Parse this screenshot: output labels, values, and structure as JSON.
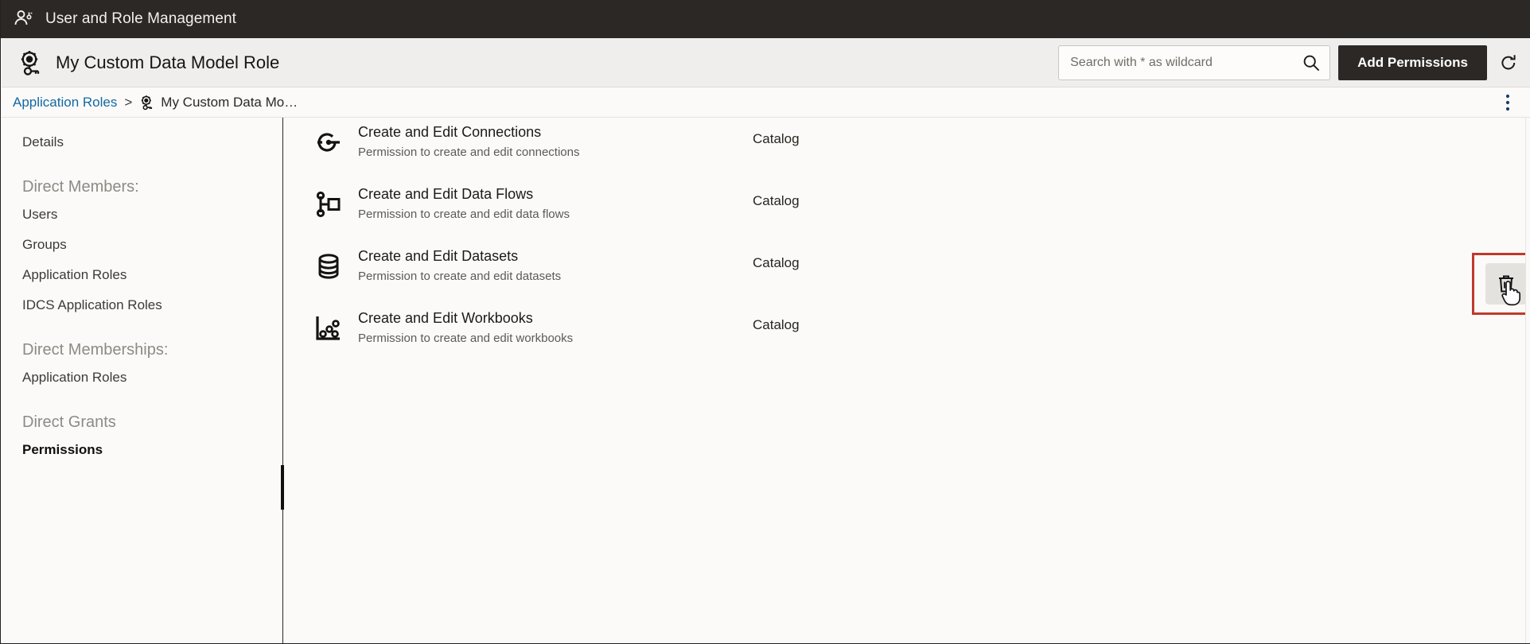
{
  "appbar": {
    "icon": "user-role-icon",
    "title": "User and Role Management"
  },
  "header": {
    "icon": "application-role-gear-icon",
    "title": "My Custom Data Model Role",
    "search": {
      "placeholder": "Search with * as wildcard",
      "value": "",
      "icon": "search-icon"
    },
    "add_permissions_label": "Add Permissions",
    "refresh_icon": "refresh-icon"
  },
  "breadcrumb": {
    "root_label": "Application Roles",
    "separator": ">",
    "current_icon": "application-role-gear-icon",
    "current_label": "My Custom Data Mo…",
    "overflow_icon": "more-vertical-icon"
  },
  "sidebar": {
    "items": [
      {
        "label": "Details",
        "type": "item",
        "selected": false
      },
      {
        "label": "Direct Members:",
        "type": "group"
      },
      {
        "label": "Users",
        "type": "item",
        "selected": false
      },
      {
        "label": "Groups",
        "type": "item",
        "selected": false
      },
      {
        "label": "Application Roles",
        "type": "item",
        "selected": false
      },
      {
        "label": "IDCS Application Roles",
        "type": "item",
        "selected": false
      },
      {
        "label": "Direct Memberships:",
        "type": "group"
      },
      {
        "label": "Application Roles",
        "type": "item",
        "selected": false
      },
      {
        "label": "Direct Grants",
        "type": "group"
      },
      {
        "label": "Permissions",
        "type": "item",
        "selected": true
      }
    ]
  },
  "permissions": {
    "rows": [
      {
        "icon": "connection-icon",
        "name": "Create and Edit Connections",
        "description": "Permission to create and edit connections",
        "scope": "Catalog"
      },
      {
        "icon": "data-flow-icon",
        "name": "Create and Edit Data Flows",
        "description": "Permission to create and edit data flows",
        "scope": "Catalog"
      },
      {
        "icon": "dataset-database-icon",
        "name": "Create and Edit Datasets",
        "description": "Permission to create and edit datasets",
        "scope": "Catalog"
      },
      {
        "icon": "workbook-scatter-icon",
        "name": "Create and Edit Workbooks",
        "description": "Permission to create and edit workbooks",
        "scope": "Catalog"
      }
    ],
    "delete_icon": "trash-delete-icon",
    "cursor_icon": "pointer-hand-cursor"
  },
  "colors": {
    "appbar_bg": "#2b2826",
    "page_bg": "#fbfaf8",
    "header_bg": "#f0eeec",
    "link": "#1269a4",
    "annotation_red": "#c0392b",
    "button_dark": "#2b2826"
  }
}
